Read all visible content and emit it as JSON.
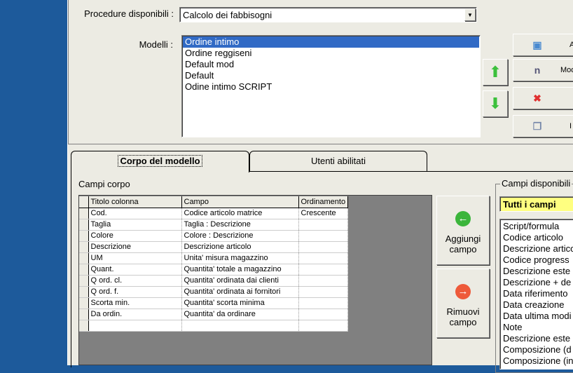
{
  "top": {
    "procedure_label": "Procedure disponibili :",
    "procedure_value": "Calcolo dei fabbisogni",
    "modelli_label": "Modelli :",
    "modelli": [
      "Ordine intimo",
      "Ordine reggiseni",
      "Default mod",
      "Default",
      "Odine intimo SCRIPT"
    ],
    "selected_index": 0,
    "side_buttons": [
      {
        "label": "A",
        "icon": "add-database-icon"
      },
      {
        "label": "Mod",
        "icon": "rename-icon"
      },
      {
        "label": "",
        "icon": "delete-x-icon"
      },
      {
        "label": "I",
        "icon": "copy-icon"
      }
    ]
  },
  "tabs": [
    {
      "label": "Corpo del modello",
      "active": true
    },
    {
      "label": "Utenti abilitati",
      "active": false
    }
  ],
  "campi_corpo": {
    "label": "Campi corpo",
    "columns": [
      "Titolo colonna",
      "Campo",
      "Ordinamento"
    ],
    "rows": [
      [
        "Cod.",
        "Codice articolo matrice",
        "Crescente"
      ],
      [
        "Taglia",
        "Taglia : Descrizione",
        ""
      ],
      [
        "Colore",
        "Colore : Descrizione",
        ""
      ],
      [
        "Descrizione",
        "Descrizione articolo",
        ""
      ],
      [
        "UM",
        "Unita' misura magazzino",
        ""
      ],
      [
        "Quant.",
        "Quantita' totale a magazzino",
        ""
      ],
      [
        "Q ord. cl.",
        "Quantita' ordinata dai clienti",
        ""
      ],
      [
        "Q ord. f.",
        "Quantita' ordinata ai fornitori",
        ""
      ],
      [
        "Scorta min.",
        "Quantita' scorta minima",
        ""
      ],
      [
        "Da ordin.",
        "Quantita' da ordinare",
        ""
      ],
      [
        "",
        "",
        ""
      ]
    ]
  },
  "buttons": {
    "add": "Aggiungi campo",
    "remove": "Rimuovi campo"
  },
  "campi_disponibili": {
    "label": "Campi disponibili",
    "filter": "Tutti i campi",
    "items": [
      "Script/formula",
      "Codice articolo",
      "Descrizione artico",
      "Codice progress",
      "Descrizione este",
      "Descrizione + de",
      "Data riferimento",
      "Data creazione",
      "Data ultima modi",
      "Note",
      "Descrizione este",
      "Composizione (d",
      "Composizione (in"
    ]
  }
}
